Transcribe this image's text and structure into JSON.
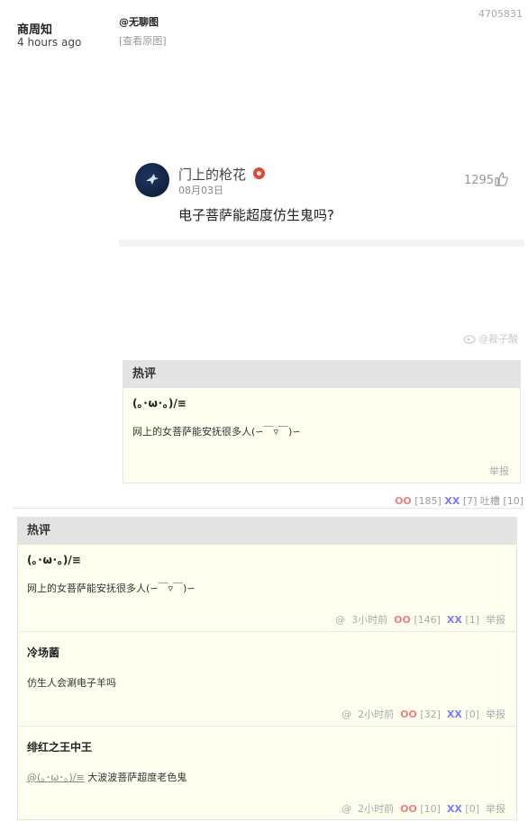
{
  "post": {
    "author": "商周知",
    "time": "4 hours ago",
    "mention": "@无聊图",
    "view_original": "[查看原图]",
    "id": "4705831"
  },
  "weibo_card": {
    "username": "门上的枪花",
    "date": "08月03日",
    "likes": "1295",
    "text": "电子菩萨能超度仿生鬼吗?",
    "watermark": "@裁子酸",
    "avatar_icon": "bird-icon",
    "like_icon": "thumbs-up-icon"
  },
  "hot_section_inline": {
    "title": "热评",
    "nickname": "(｡･ω･｡)/≡",
    "text": "网上的女菩萨能安抚很多人(∽￣▿￣)∽",
    "report": "举报"
  },
  "post_votes": {
    "oo_label": "OO",
    "oo_count": "[185]",
    "xx_label": "XX",
    "xx_count": "[7]",
    "tucao": "吐槽 [10]"
  },
  "hot_comments": {
    "title": "热评",
    "items": [
      {
        "nickname": "(｡･ω･｡)/≡",
        "text": "网上的女菩萨能安抚很多人(∽￣▿￣)∽",
        "at": "@",
        "time": "3小时前",
        "oo_label": "OO",
        "oo_count": "[146]",
        "xx_label": "XX",
        "xx_count": "[1]",
        "report": "举报"
      },
      {
        "nickname": "冷场菌",
        "text": "仿生人会涮电子羊吗",
        "at": "@",
        "time": "2小时前",
        "oo_label": "OO",
        "oo_count": "[32]",
        "xx_label": "XX",
        "xx_count": "[0]",
        "report": "举报"
      },
      {
        "nickname": "绯红之王中王",
        "reply_to": "@(｡･ω･｡)/≡",
        "text": "大波波菩萨超度老色鬼",
        "at": "@",
        "time": "2小时前",
        "oo_label": "OO",
        "oo_count": "[10]",
        "xx_label": "XX",
        "xx_count": "[0]",
        "report": "举报"
      }
    ]
  },
  "colors": {
    "oo": "#f08080",
    "xx": "#7b7bff",
    "hot_header_bg": "#e3e3e3",
    "comment_bg": "#fffff0",
    "badge": "#e2463a"
  }
}
